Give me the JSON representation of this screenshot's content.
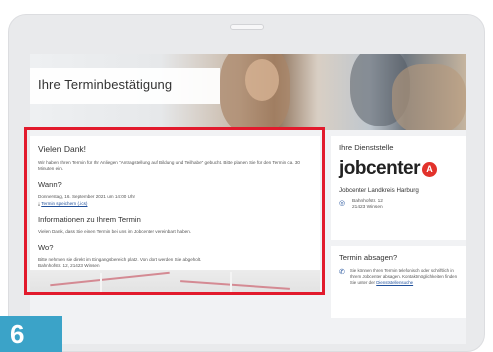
{
  "hero": {
    "title": "Ihre Terminbestätigung"
  },
  "confirmation": {
    "thanks_title": "Vielen Dank!",
    "thanks_text": "Wir haben Ihren Termin für Ihr Anliegen \"Antragstellung auf Bildung und Teilhabe\" gebucht. Bitte planen Sie für den Termin ca. 30 Minuten ein.",
    "when_title": "Wann?",
    "when_date": "Donnerstag, 16. September 2021 um 14:00 Uhr",
    "calendar_link": "Termin speichern (.ics)",
    "info_title": "Informationen zu Ihrem Termin",
    "info_text": "Vielen Dank, dass Sie einen Termin bei uns im Jobcenter vereinbart haben.",
    "where_title": "Wo?",
    "where_text": "Bitte nehmen sie direkt im Eingangsbereich platz. Von dort werden Sie abgeholt.",
    "where_address": "Bahnhofstr. 12, 21423 Winsen"
  },
  "office": {
    "title": "Ihre Dienststelle",
    "logo_text": "jobcenter",
    "name": "Jobcenter Landkreis Harburg",
    "street": "Bahnhofstr. 12",
    "city": "21423 Winsen"
  },
  "cancel": {
    "title": "Termin absagen?",
    "text": "Sie können Ihren Termin telefonisch oder schriftlich in Ihrem Jobcenter absagen. Kontaktmöglichkeiten finden Sie unter der",
    "link": "Dienststellensuche"
  },
  "step": {
    "number": "6"
  },
  "colors": {
    "highlight": "#e21a2c",
    "brand_red": "#e2322b",
    "step_blue": "#3ba3c8",
    "link": "#1f4f9a"
  }
}
